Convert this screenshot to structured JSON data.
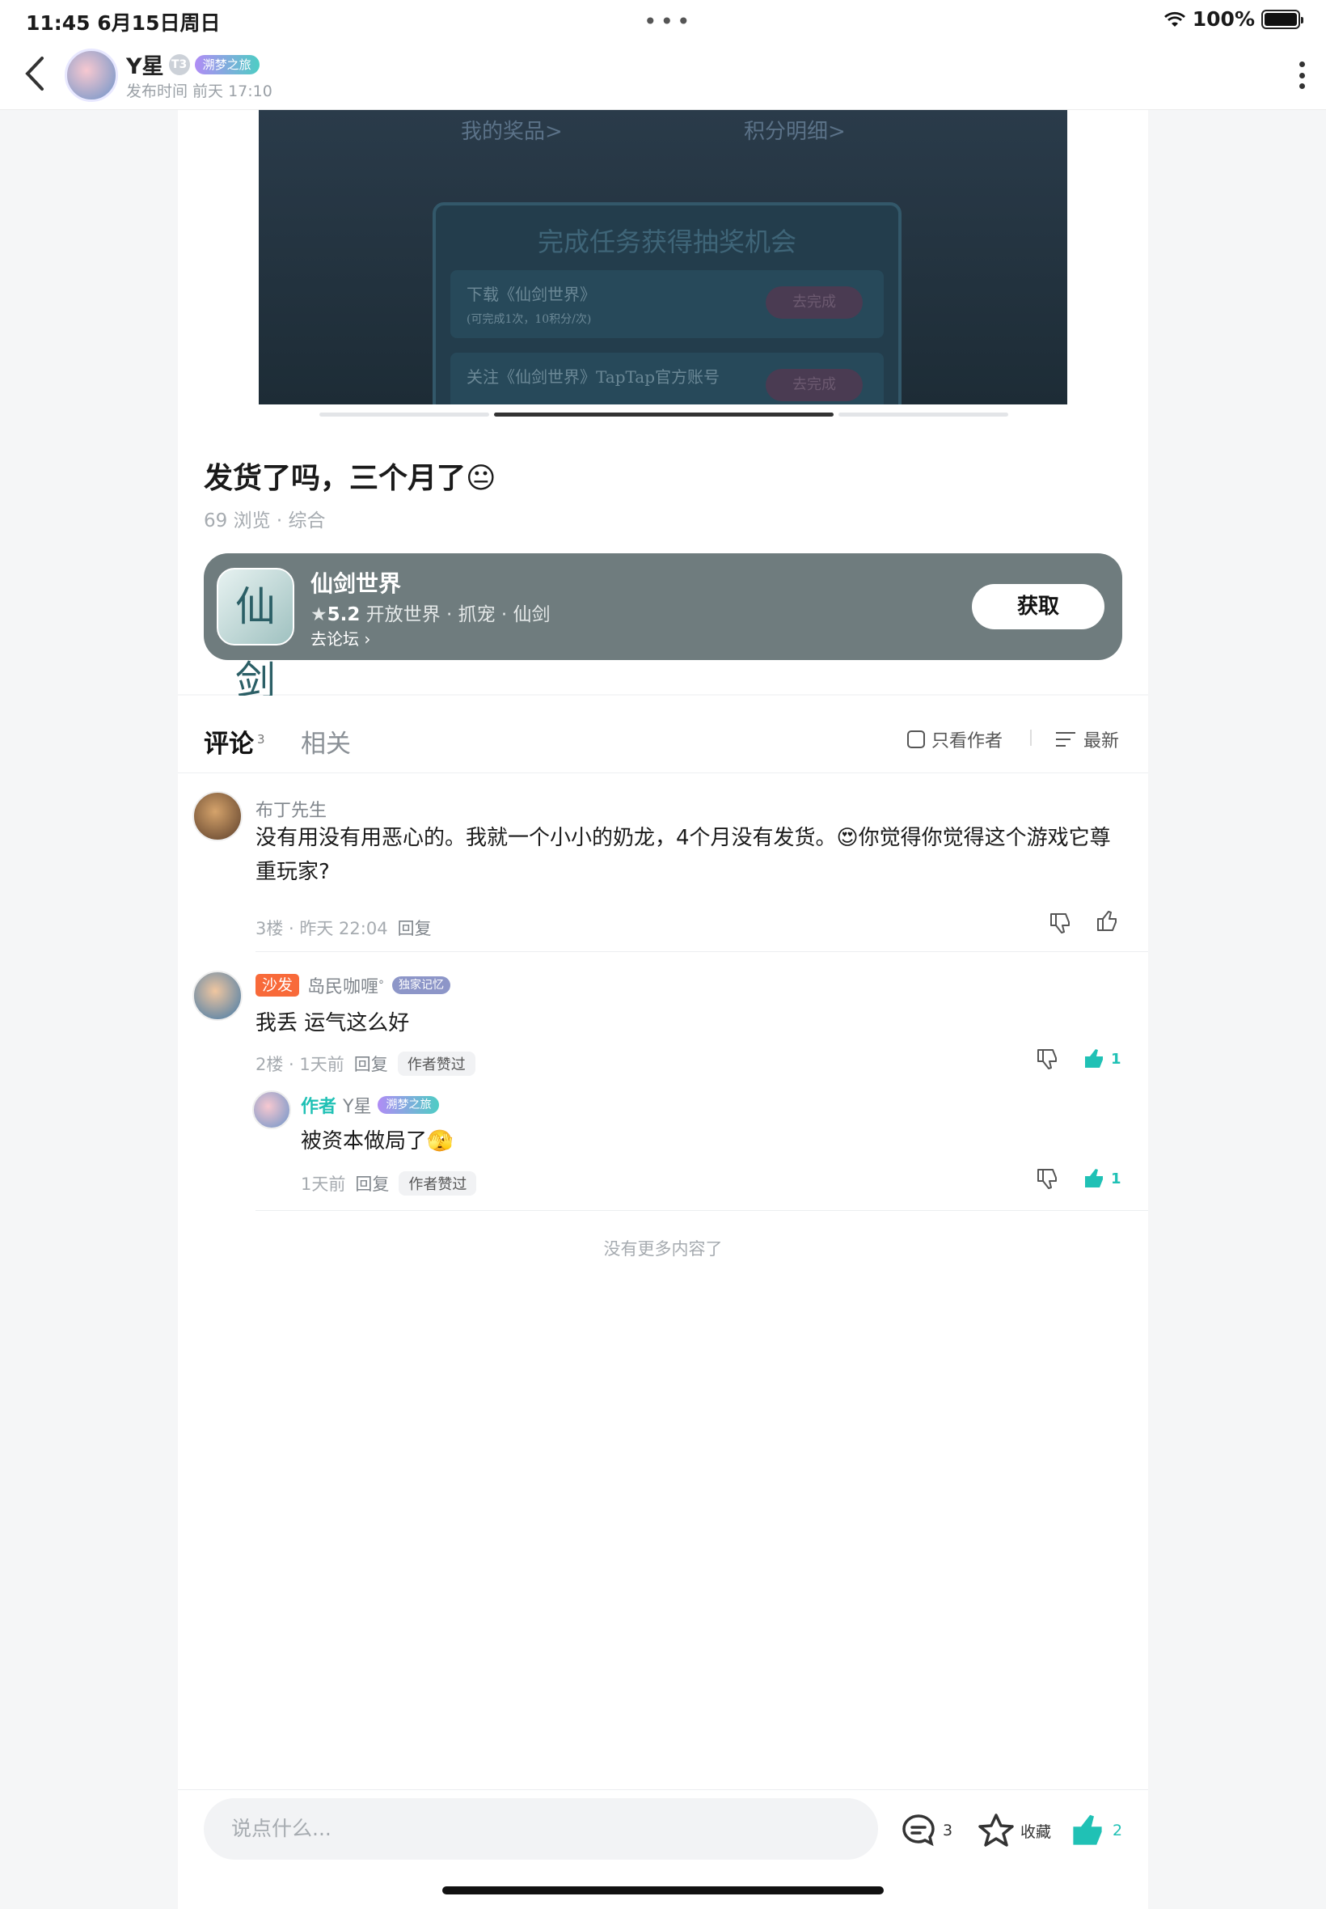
{
  "status_bar": {
    "time_date": "11:45   6月15日周日",
    "battery": "100%"
  },
  "header": {
    "author": "Y星",
    "level": "T3",
    "badge": "溯梦之旅",
    "publish_time": "发布时间 前天 17:10"
  },
  "image_banner": {
    "link1": "我的奖品>",
    "link2": "积分明细>",
    "box_title": "完成任务获得抽奖机会",
    "task1": "下载《仙剑世界》",
    "task1_sub": "(可完成1次，10积分/次)",
    "task1_btn": "去完成",
    "task2": "关注《仙剑世界》TapTap官方账号",
    "task2_btn": "去完成"
  },
  "post": {
    "title": "发货了吗，三个月了😐",
    "views": "69 浏览 · 综合"
  },
  "game": {
    "name": "仙剑世界",
    "rating": "5.2",
    "tags": " 开放世界 · 抓宠 · 仙剑",
    "forum": "去论坛 ",
    "get_button": "获取",
    "icon_glyph": "仙剑"
  },
  "tabs": {
    "comments": "评论",
    "comments_count": "3",
    "related": "相关",
    "only_author": "只看作者",
    "sort": "最新"
  },
  "comments": [
    {
      "name": "布丁先生",
      "text": "没有用没有用恶心的。我就一个小小的奶龙，4个月没有发货。😍你觉得你觉得这个游戏它尊重玩家?",
      "floor": "3楼 · 昨天 22:04",
      "reply": "回复"
    },
    {
      "sofa": "沙发",
      "name": "岛民咖喱",
      "name_mark": "°",
      "badge": "独家记忆",
      "text": "我丢 运气这么好",
      "floor": "2楼 · 1天前",
      "reply": "回复",
      "chip": "作者赞过",
      "likes": "1"
    }
  ],
  "sub_reply": {
    "author_label": "作者",
    "name": "Y星",
    "badge": "溯梦之旅",
    "text": "被资本做局了🫣",
    "time": "1天前",
    "reply": "回复",
    "chip": "作者赞过",
    "likes": "1"
  },
  "no_more": "没有更多内容了",
  "bottom_bar": {
    "placeholder": "说点什么...",
    "comment_count": "3",
    "collect": "收藏",
    "like_count": "2"
  },
  "colors": {
    "accent": "#20c1b5",
    "sofa": "#f86a3a",
    "game_bg": "#6f7c7e"
  }
}
